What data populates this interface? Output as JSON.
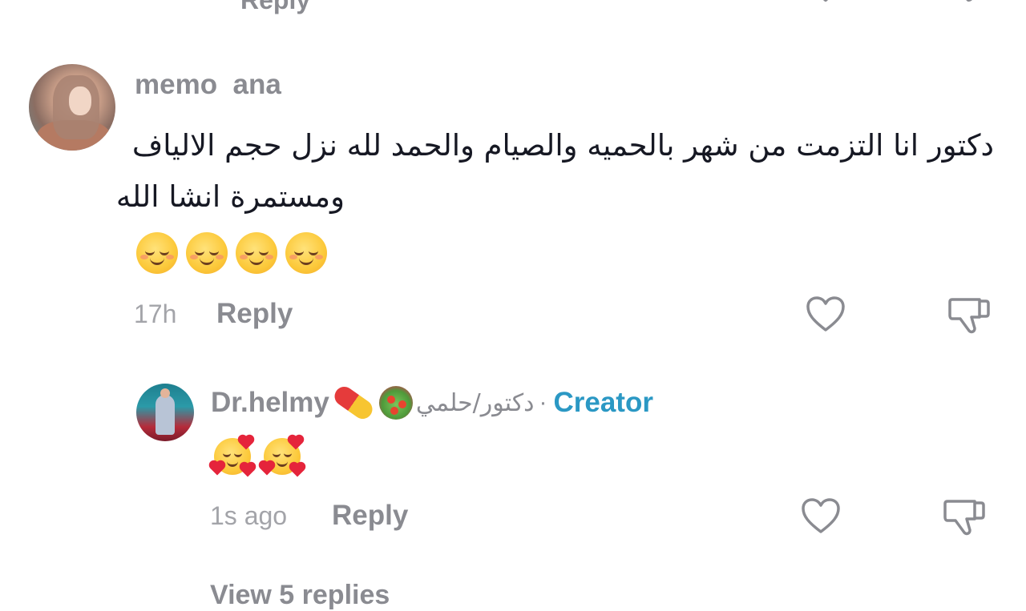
{
  "previous_comment": {
    "reply_label": "Reply"
  },
  "comments": [
    {
      "username": "memo  ana",
      "text_line_1": "دكتور انا التزمت من شهر بالحميه والصيام والحمد لله نزل حجم الالياف",
      "text_line_2": "ومستمرة انشا الله",
      "emoji_reaction": "☺️☺️☺️☺️",
      "time": "17h",
      "reply_label": "Reply"
    },
    {
      "username": "Dr.helmy",
      "name_suffix_ar": "دكتور/حلمي",
      "separator": "·",
      "badge": "Creator",
      "emoji_reaction": "🥰🥰",
      "time": "1s ago",
      "reply_label": "Reply"
    }
  ],
  "view_replies_label": "View 5 replies",
  "colors": {
    "creator_badge": "#2b98c4",
    "secondary_text": "#8a8b91",
    "primary_text": "#161823",
    "icon_stroke": "#8a8b91"
  },
  "icons": {
    "like": "heart-outline-icon",
    "dislike": "thumbs-down-outline-icon"
  }
}
